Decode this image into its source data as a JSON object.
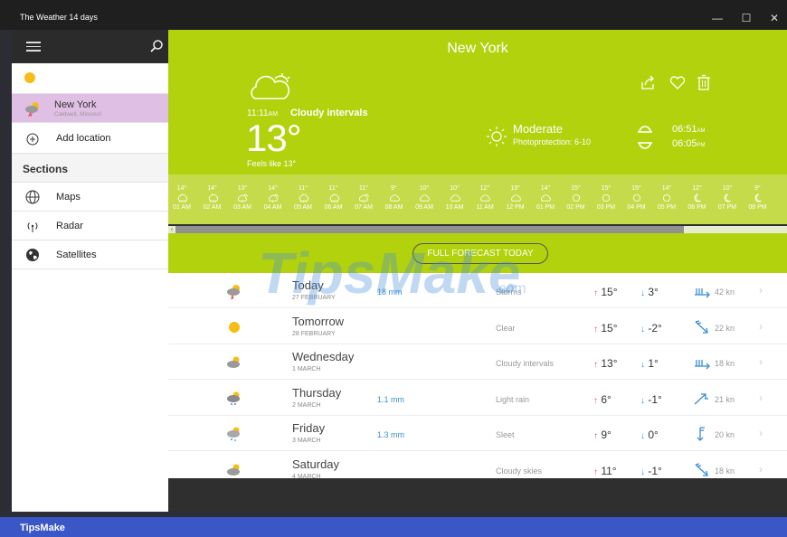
{
  "window": {
    "title": "The Weather 14 days",
    "controls": {
      "min": "—",
      "max": "☐",
      "close": "✕"
    }
  },
  "sidebar": {
    "location": {
      "name": "New York",
      "sub": "Caldwell, Missouri"
    },
    "add_location": "Add location",
    "sections_label": "Sections",
    "items": [
      {
        "label": "Maps"
      },
      {
        "label": "Radar"
      },
      {
        "label": "Satellites"
      }
    ]
  },
  "hero": {
    "city": "New York",
    "time": "11:11",
    "time_suffix": "AM",
    "condition": "Cloudy intervals",
    "temperature": "13°",
    "feels_like": "Feels like 13°",
    "uv_level": "Moderate",
    "uv_text": "Photoprotection: 6-10",
    "sunrise": "06:51",
    "sunrise_suffix": "AM",
    "sunset": "06:05",
    "sunset_suffix": "PM"
  },
  "hourly": [
    {
      "temp": "14°",
      "label": "01 AM",
      "icon": "rain"
    },
    {
      "temp": "14°",
      "label": "02 AM",
      "icon": "rain"
    },
    {
      "temp": "13°",
      "label": "03 AM",
      "icon": "rain-sun"
    },
    {
      "temp": "14°",
      "label": "04 AM",
      "icon": "rain-sun"
    },
    {
      "temp": "11°",
      "label": "05 AM",
      "icon": "rain"
    },
    {
      "temp": "11°",
      "label": "06 AM",
      "icon": "rain"
    },
    {
      "temp": "11°",
      "label": "07 AM",
      "icon": "rain-sun"
    },
    {
      "temp": "9°",
      "label": "08 AM",
      "icon": "cloud"
    },
    {
      "temp": "10°",
      "label": "09 AM",
      "icon": "cloud"
    },
    {
      "temp": "10°",
      "label": "10 AM",
      "icon": "cloud"
    },
    {
      "temp": "12°",
      "label": "11 AM",
      "icon": "cloud"
    },
    {
      "temp": "13°",
      "label": "12 PM",
      "icon": "cloud"
    },
    {
      "temp": "14°",
      "label": "01 PM",
      "icon": "cloud"
    },
    {
      "temp": "15°",
      "label": "02 PM",
      "icon": "sun"
    },
    {
      "temp": "15°",
      "label": "03 PM",
      "icon": "sun"
    },
    {
      "temp": "15°",
      "label": "04 PM",
      "icon": "sun"
    },
    {
      "temp": "14°",
      "label": "05 PM",
      "icon": "sun"
    },
    {
      "temp": "12°",
      "label": "06 PM",
      "icon": "moon"
    },
    {
      "temp": "10°",
      "label": "07 PM",
      "icon": "moon"
    },
    {
      "temp": "9°",
      "label": "08 PM",
      "icon": "moon"
    }
  ],
  "forecast_button": "FULL FORECAST TODAY",
  "days": [
    {
      "name": "Today",
      "date": "27 FEBRUARY",
      "precip": "18 mm",
      "cond": "Storms",
      "high": "15°",
      "low": "3°",
      "wind": "42 kn",
      "icon": "storm",
      "wind_icon": "wind-w"
    },
    {
      "name": "Tomorrow",
      "date": "28 FEBRUARY",
      "precip": "",
      "cond": "Clear",
      "high": "15°",
      "low": "-2°",
      "wind": "22 kn",
      "icon": "sun",
      "wind_icon": "wind-nw"
    },
    {
      "name": "Wednesday",
      "date": "1 MARCH",
      "precip": "",
      "cond": "Cloudy intervals",
      "high": "13°",
      "low": "1°",
      "wind": "18 kn",
      "icon": "cloud",
      "wind_icon": "wind-w"
    },
    {
      "name": "Thursday",
      "date": "2 MARCH",
      "precip": "1.1 mm",
      "cond": "Light rain",
      "high": "6°",
      "low": "-1°",
      "wind": "21 kn",
      "icon": "rain",
      "wind_icon": "wind-sw"
    },
    {
      "name": "Friday",
      "date": "3 MARCH",
      "precip": "1.3 mm",
      "cond": "Sleet",
      "high": "9°",
      "low": "0°",
      "wind": "20 kn",
      "icon": "sleet",
      "wind_icon": "wind-s"
    },
    {
      "name": "Saturday",
      "date": "4 MARCH",
      "precip": "",
      "cond": "Cloudy skies",
      "high": "11°",
      "low": "-1°",
      "wind": "18 kn",
      "icon": "cloud",
      "wind_icon": "wind-nw"
    }
  ],
  "watermark": "TipsMake",
  "watermark_suffix": ".com",
  "footer_brand": "TipsMake",
  "colors": {
    "accent": "#b2d20d",
    "strip": "#c6db4a",
    "selected": "#e0bfe4",
    "footer": "#3a56c7"
  }
}
